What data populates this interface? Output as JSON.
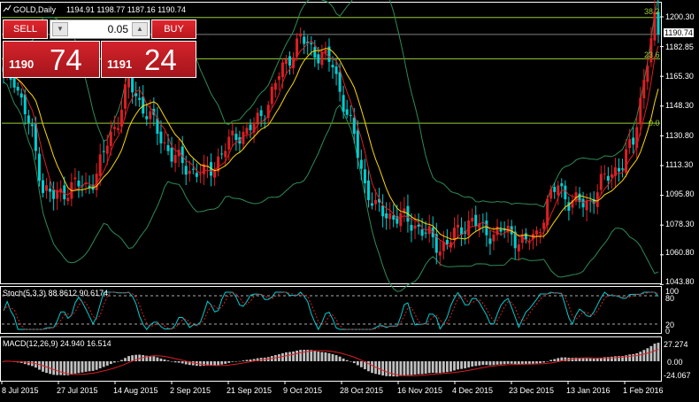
{
  "header": {
    "symbol_timeframe": "GOLD,Daily",
    "ohlc": "1194.91 1198.77 1187.16 1190.74"
  },
  "trade_panel": {
    "sell_label": "SELL",
    "buy_label": "BUY",
    "lot_value": "0.05",
    "sell_price_prefix": "1190",
    "sell_price_main": "74",
    "buy_price_prefix": "1191",
    "buy_price_main": "24"
  },
  "main_axis": {
    "ticks": [
      "1200.30",
      "1182.85",
      "1165.30",
      "1148.30",
      "1130.80",
      "1113.30",
      "1095.80",
      "1078.30",
      "1060.80",
      "1043.80"
    ],
    "current_price": "1190.74"
  },
  "fib_levels": [
    {
      "label": "38.2",
      "color": "#9acd32"
    },
    {
      "label": "23.6",
      "color": "#9acd32"
    },
    {
      "label": "0.0",
      "color": "#9acd32"
    }
  ],
  "stoch": {
    "label": "Stoch(5,3,3) 88.8612 90.6174",
    "ticks": [
      "100",
      "80",
      "20",
      "0"
    ]
  },
  "macd": {
    "label": "MACD(12,26,9) 24.940 16.514",
    "ticks": [
      "27.274",
      "0.00",
      "-24.067"
    ]
  },
  "x_axis": {
    "labels": [
      "8 Jul 2015",
      "27 Jul 2015",
      "14 Aug 2015",
      "2 Sep 2015",
      "21 Sep 2015",
      "9 Oct 2015",
      "28 Oct 2015",
      "16 Nov 2015",
      "4 Dec 2015",
      "23 Dec 2015",
      "13 Jan 2016",
      "1 Feb 2016"
    ]
  },
  "colors": {
    "bull": "#dc1e24",
    "bear": "#00ced1",
    "ma_fast": "#dc1e24",
    "ma_slow": "#ffd700",
    "bands": "#2e8b57",
    "fib": "#9acd32",
    "grid": "#808080",
    "stoch_main": "#dc1e24",
    "stoch_signal": "#00ced1",
    "macd_hist": "#c0c0c0",
    "macd_signal": "#dc1e24"
  },
  "chart_data": {
    "type": "candlestick",
    "price_range": [
      1040.0,
      1210.0
    ],
    "close_path": [
      [
        0,
        1165
      ],
      [
        3,
        1165
      ],
      [
        5,
        1150
      ],
      [
        8,
        1130
      ],
      [
        11,
        1098
      ],
      [
        14,
        1092
      ],
      [
        17,
        1096
      ],
      [
        20,
        1100
      ],
      [
        23,
        1098
      ],
      [
        26,
        1106
      ],
      [
        29,
        1125
      ],
      [
        32,
        1140
      ],
      [
        35,
        1162
      ],
      [
        38,
        1150
      ],
      [
        41,
        1140
      ],
      [
        44,
        1128
      ],
      [
        47,
        1118
      ],
      [
        50,
        1112
      ],
      [
        53,
        1108
      ],
      [
        56,
        1106
      ],
      [
        59,
        1112
      ],
      [
        62,
        1122
      ],
      [
        65,
        1130
      ],
      [
        68,
        1132
      ],
      [
        71,
        1138
      ],
      [
        74,
        1150
      ],
      [
        77,
        1166
      ],
      [
        80,
        1178
      ],
      [
        83,
        1188
      ],
      [
        86,
        1182
      ],
      [
        89,
        1178
      ],
      [
        92,
        1172
      ],
      [
        95,
        1150
      ],
      [
        98,
        1128
      ],
      [
        101,
        1100
      ],
      [
        104,
        1085
      ],
      [
        107,
        1082
      ],
      [
        110,
        1080
      ],
      [
        113,
        1078
      ],
      [
        116,
        1074
      ],
      [
        119,
        1068
      ],
      [
        122,
        1062
      ],
      [
        125,
        1066
      ],
      [
        128,
        1074
      ],
      [
        131,
        1078
      ],
      [
        134,
        1072
      ],
      [
        137,
        1070
      ],
      [
        140,
        1072
      ],
      [
        143,
        1068
      ],
      [
        146,
        1064
      ],
      [
        149,
        1070
      ],
      [
        152,
        1088
      ],
      [
        155,
        1100
      ],
      [
        158,
        1090
      ],
      [
        161,
        1088
      ],
      [
        164,
        1090
      ],
      [
        167,
        1100
      ],
      [
        170,
        1108
      ],
      [
        173,
        1112
      ],
      [
        176,
        1126
      ],
      [
        178,
        1152
      ],
      [
        180,
        1175
      ],
      [
        182,
        1198
      ],
      [
        183,
        1190.74
      ]
    ]
  }
}
